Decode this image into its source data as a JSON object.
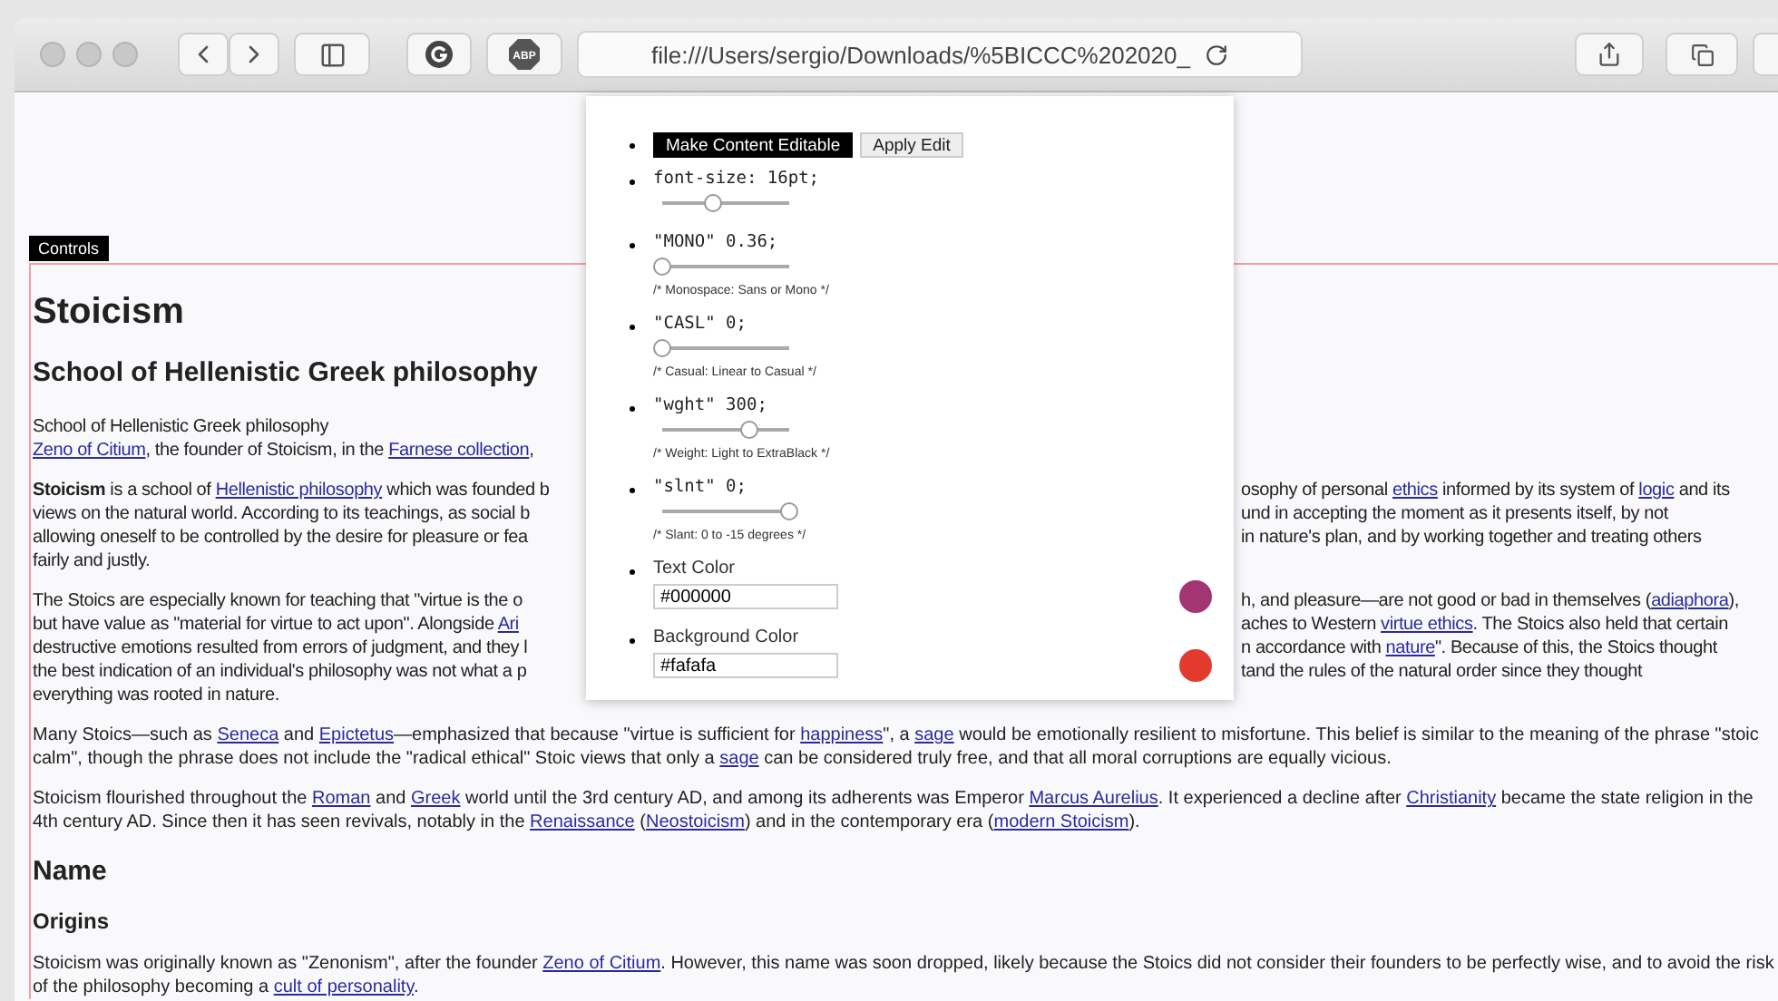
{
  "browser": {
    "address": "file:///Users/sergio/Downloads/%5BICCC%202020_",
    "adblock_label": "ABP"
  },
  "controls_tab": "Controls",
  "panel": {
    "buttons": [
      {
        "label": "Make Content Editable",
        "kind": "primary"
      },
      {
        "label": "Apply Edit",
        "kind": "secondary"
      }
    ],
    "sliders": [
      {
        "label": "font-size: 16pt;",
        "level": 0.4
      },
      {
        "label": "\"MONO\" 0.36;",
        "level": 0,
        "comment": "/* Monospace: Sans or Mono */"
      },
      {
        "label": "\"CASL\" 0;",
        "level": 0,
        "comment": "/* Casual: Linear to Casual */"
      },
      {
        "label": "\"wght\" 300;",
        "level": 0.68,
        "comment": "/* Weight: Light to ExtraBlack */"
      },
      {
        "label": "\"slnt\" 0;",
        "level": 1,
        "comment": "/* Slant: 0 to -15 degrees */"
      }
    ],
    "colors": [
      {
        "label": "Text Color",
        "value": "#000000",
        "color": "#a23572"
      },
      {
        "label": "Background Color",
        "value": "#fafafa",
        "color": "#e23b2e"
      }
    ]
  },
  "article": {
    "title": "Stoicism",
    "subtitle": "School of Hellenistic Greek philosophy",
    "blocks": [
      {
        "kind": "split",
        "lines": [
          {
            "left": [
              {
                "kind": "text",
                "text": "School of Hellenistic Greek philosophy"
              }
            ]
          },
          {
            "left": [
              {
                "kind": "link",
                "text": "Zeno of Citium"
              },
              {
                "kind": "text",
                "text": ", the founder of Stoicism, in the "
              },
              {
                "kind": "link",
                "text": "Farnese collection"
              },
              {
                "kind": "text",
                "text": ","
              }
            ]
          }
        ]
      },
      {
        "kind": "split",
        "lines": [
          {
            "left": [
              {
                "kind": "bold",
                "text": "Stoicism"
              },
              {
                "kind": "text",
                "text": " is a school of "
              },
              {
                "kind": "link",
                "text": "Hellenistic philosophy"
              },
              {
                "kind": "text",
                "text": " which was founded b"
              }
            ],
            "right": [
              {
                "kind": "text",
                "text": "osophy of personal "
              },
              {
                "kind": "link",
                "text": "ethics"
              },
              {
                "kind": "text",
                "text": " informed by its system of "
              },
              {
                "kind": "link",
                "text": "logic"
              },
              {
                "kind": "text",
                "text": " and its"
              }
            ]
          },
          {
            "left": [
              {
                "kind": "text",
                "text": "views on the natural world. According to its teachings, as social b"
              }
            ],
            "right": [
              {
                "kind": "text",
                "text": "und in accepting the moment as it presents itself, by not"
              }
            ]
          },
          {
            "left": [
              {
                "kind": "text",
                "text": "allowing oneself to be controlled by the desire for pleasure or fea"
              }
            ],
            "right": [
              {
                "kind": "text",
                "text": "in nature's plan, and by working together and treating others"
              }
            ]
          },
          {
            "left": [
              {
                "kind": "text",
                "text": "fairly and justly."
              }
            ]
          }
        ]
      },
      {
        "kind": "split",
        "lines": [
          {
            "left": [
              {
                "kind": "text",
                "text": "The Stoics are especially known for teaching that \"virtue is the o"
              }
            ],
            "right": [
              {
                "kind": "text",
                "text": "h, and pleasure—are not good or bad in themselves ("
              },
              {
                "kind": "link",
                "text": "adiaphora"
              },
              {
                "kind": "text",
                "text": "),"
              }
            ]
          },
          {
            "left": [
              {
                "kind": "text",
                "text": "but have value as \"material for virtue to act upon\". Alongside "
              },
              {
                "kind": "link",
                "text": "Ari"
              }
            ],
            "right": [
              {
                "kind": "text",
                "text": "aches to Western "
              },
              {
                "kind": "link",
                "text": "virtue ethics"
              },
              {
                "kind": "text",
                "text": ". The Stoics also held that certain"
              }
            ]
          },
          {
            "left": [
              {
                "kind": "text",
                "text": "destructive emotions resulted from errors of judgment, and they l"
              }
            ],
            "right": [
              {
                "kind": "text",
                "text": "n accordance with "
              },
              {
                "kind": "link",
                "text": "nature"
              },
              {
                "kind": "text",
                "text": "\". Because of this, the Stoics thought"
              }
            ]
          },
          {
            "left": [
              {
                "kind": "text",
                "text": "the best indication of an individual's philosophy was not what a p"
              }
            ],
            "right": [
              {
                "kind": "text",
                "text": "tand the rules of the natural order since they thought"
              }
            ]
          },
          {
            "left": [
              {
                "kind": "text",
                "text": "everything was rooted in nature."
              }
            ]
          }
        ]
      },
      {
        "kind": "paragraph",
        "runs": [
          {
            "kind": "text",
            "text": "Many Stoics—such as "
          },
          {
            "kind": "link",
            "text": "Seneca"
          },
          {
            "kind": "text",
            "text": " and "
          },
          {
            "kind": "link",
            "text": "Epictetus"
          },
          {
            "kind": "text",
            "text": "—emphasized that because \"virtue is sufficient for "
          },
          {
            "kind": "link",
            "text": "happiness"
          },
          {
            "kind": "text",
            "text": "\", a "
          },
          {
            "kind": "link",
            "text": "sage"
          },
          {
            "kind": "text",
            "text": " would be emotionally resilient to misfortune. This belief is similar to the meaning of the phrase \"stoic calm\", though the phrase does not include the \"radical ethical\" Stoic views that only a "
          },
          {
            "kind": "link",
            "text": "sage"
          },
          {
            "kind": "text",
            "text": " can be considered truly free, and that all moral corruptions are equally vicious."
          }
        ]
      },
      {
        "kind": "paragraph",
        "runs": [
          {
            "kind": "text",
            "text": "Stoicism flourished throughout the "
          },
          {
            "kind": "link",
            "text": "Roman"
          },
          {
            "kind": "text",
            "text": " and "
          },
          {
            "kind": "link",
            "text": "Greek"
          },
          {
            "kind": "text",
            "text": " world until the 3rd century AD, and among its adherents was Emperor "
          },
          {
            "kind": "link",
            "text": "Marcus Aurelius"
          },
          {
            "kind": "text",
            "text": ". It experienced a decline after "
          },
          {
            "kind": "link",
            "text": "Christianity"
          },
          {
            "kind": "text",
            "text": " became the state religion in the 4th century AD. Since then it has seen revivals, notably in the "
          },
          {
            "kind": "link",
            "text": "Renaissance"
          },
          {
            "kind": "text",
            "text": " ("
          },
          {
            "kind": "link",
            "text": "Neostoicism"
          },
          {
            "kind": "text",
            "text": ") and in the contemporary era ("
          },
          {
            "kind": "link",
            "text": "modern Stoicism"
          },
          {
            "kind": "text",
            "text": ")."
          }
        ]
      },
      {
        "kind": "heading",
        "text": "Name"
      },
      {
        "kind": "subheading",
        "text": "Origins"
      },
      {
        "kind": "paragraph",
        "runs": [
          {
            "kind": "text",
            "text": "Stoicism was originally known as \"Zenonism\", after the founder "
          },
          {
            "kind": "link",
            "text": "Zeno of Citium"
          },
          {
            "kind": "text",
            "text": ". However, this name was soon dropped, likely because the Stoics did not consider their founders to be perfectly wise, and to avoid the risk of the philosophy becoming a "
          },
          {
            "kind": "link",
            "text": "cult of personality"
          },
          {
            "kind": "text",
            "text": "."
          }
        ]
      }
    ]
  }
}
